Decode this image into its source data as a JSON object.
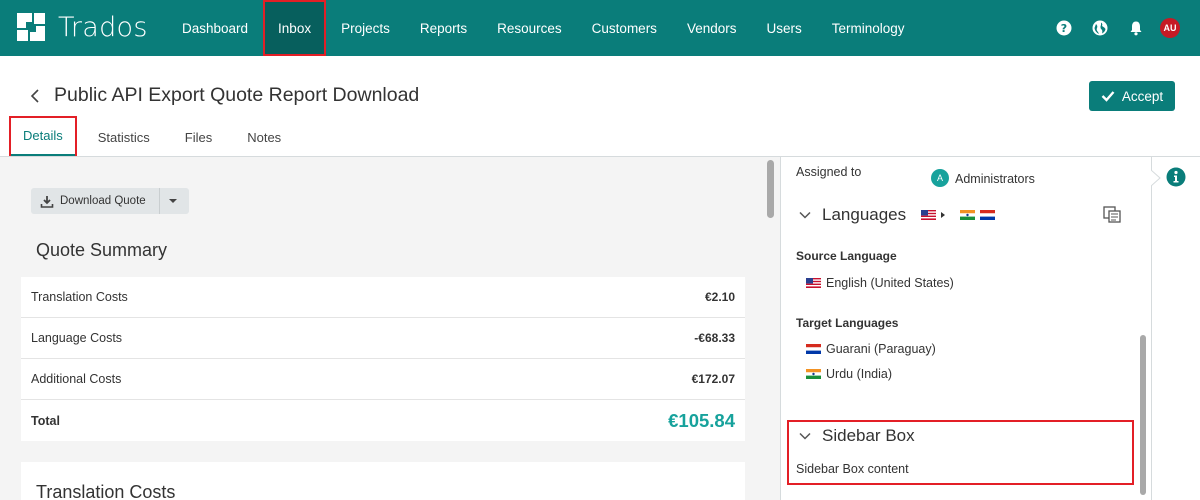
{
  "app": {
    "name": "Trados"
  },
  "nav": {
    "items": [
      {
        "label": "Dashboard"
      },
      {
        "label": "Inbox"
      },
      {
        "label": "Projects"
      },
      {
        "label": "Reports"
      },
      {
        "label": "Resources"
      },
      {
        "label": "Customers"
      },
      {
        "label": "Vendors"
      },
      {
        "label": "Users"
      },
      {
        "label": "Terminology"
      }
    ],
    "active_index": 1
  },
  "user": {
    "initials": "AU"
  },
  "page": {
    "title": "Public API Export Quote Report Download",
    "accept_label": "Accept"
  },
  "tabs": [
    {
      "label": "Details"
    },
    {
      "label": "Statistics"
    },
    {
      "label": "Files"
    },
    {
      "label": "Notes"
    }
  ],
  "quote": {
    "download_label": "Download Quote",
    "summary_title": "Quote Summary",
    "rows": [
      {
        "label": "Translation Costs",
        "amount": "€2.10"
      },
      {
        "label": "Language Costs",
        "amount": "-€68.33"
      },
      {
        "label": "Additional Costs",
        "amount": "€172.07"
      },
      {
        "label": "Total",
        "amount": "€105.84"
      }
    ],
    "translation_costs_title": "Translation Costs"
  },
  "sidebar": {
    "assigned_to_label": "Assigned to",
    "assignee_initial": "A",
    "assignee_name": "Administrators",
    "languages_title": "Languages",
    "source_label": "Source Language",
    "source_language": "English (United States)",
    "target_label": "Target Languages",
    "target_languages": [
      "Guarani (Paraguay)",
      "Urdu (India)"
    ],
    "box_title": "Sidebar Box",
    "box_content": "Sidebar Box content"
  },
  "colors": {
    "brand": "#0a7d7a",
    "accent": "#17a29c",
    "highlight": "#e31f26"
  }
}
